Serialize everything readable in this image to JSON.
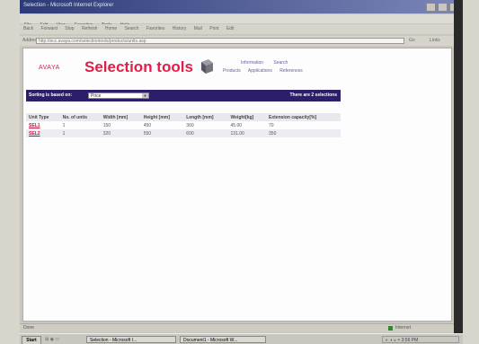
{
  "window": {
    "title": "Selection - Microsoft Internet Explorer"
  },
  "menubar": {
    "items": [
      "File",
      "Edit",
      "View",
      "Favorites",
      "Tools",
      "Help"
    ]
  },
  "toolbar": {
    "items": [
      "Back",
      "Forward",
      "Stop",
      "Refresh",
      "Home",
      "Search",
      "Favorites",
      "History",
      "Mail",
      "Print",
      "Edit"
    ]
  },
  "address": {
    "label": "Address",
    "value": "http://ecc.avaya.com/selectiontools/products/units.asp",
    "go": "Go",
    "links": "Links"
  },
  "page": {
    "logo": "AVAYA",
    "title": "Selection tools",
    "nav_row1": [
      "Information",
      "Search"
    ],
    "nav_row2": [
      "Products",
      "Applications",
      "References"
    ],
    "sort_label": "Sorting is based on:",
    "sort_value": "Price",
    "result_count": "There are 2 selections",
    "table": {
      "headers": [
        "Unit Type",
        "No. of units",
        "Width [mm]",
        "Height [mm]",
        "Length [mm]",
        "Weight[kg]",
        "Extension capacity[%]"
      ],
      "rows": [
        [
          "SEL1",
          "1",
          "150",
          "450",
          "360",
          "45.00",
          "70"
        ],
        [
          "SEL2",
          "1",
          "320",
          "550",
          "600",
          "131.00",
          "350"
        ]
      ]
    }
  },
  "statusbar": {
    "left": "Done",
    "right": "Internet"
  },
  "taskbar": {
    "start": "Start",
    "quicklaunch": "⊞ ◉ ▭",
    "tasks": [
      "Selection - Microsoft I...",
      "Document1 - Microsoft W..."
    ],
    "tray": "◐ ◑ ◒ ◓ 3:56 PM"
  }
}
